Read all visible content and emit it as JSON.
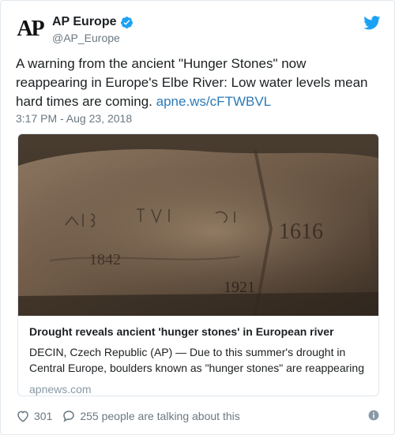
{
  "account": {
    "display_name": "AP Europe",
    "handle": "@AP_Europe",
    "avatar_text": "AP"
  },
  "tweet": {
    "text": "A warning from the ancient \"Hunger Stones\" now reappearing in Europe's Elbe River: Low water levels mean hard times are coming.",
    "link": "apne.ws/cFTWBVL",
    "timestamp": "3:17 PM - Aug 23, 2018"
  },
  "card": {
    "title": "Drought reveals ancient 'hunger stones' in European river",
    "description": "DECIN, Czech Republic (AP) — Due to this summer's drought in Central Europe, boulders known as \"hunger stones\" are reappearing",
    "domain": "apnews.com",
    "image_alt": "Hunger stone with carved years 1616, 1842, 1921",
    "carvings": [
      "1616",
      "1842",
      "1921"
    ]
  },
  "footer": {
    "likes": "301",
    "talking": "255 people are talking about this"
  },
  "icons": {
    "verified": "verified-badge-icon",
    "brand": "twitter-bird-icon",
    "like": "heart-icon",
    "reply": "speech-bubble-icon",
    "info": "info-icon"
  },
  "colors": {
    "link": "#2b7bb9",
    "twitter_blue": "#1da1f2",
    "muted": "#697882"
  }
}
